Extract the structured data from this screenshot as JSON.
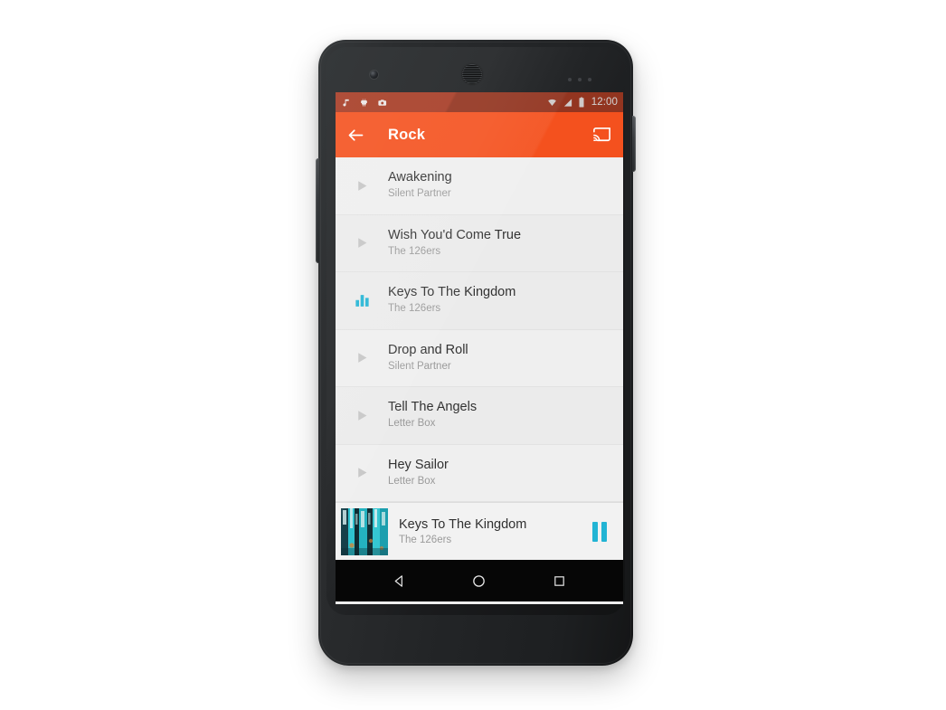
{
  "device": {
    "name": "android-phone-mockup",
    "hardware": {
      "front_camera": "camera-icon",
      "earpiece": "speaker-grille-icon",
      "sensors": "proximity-sensor",
      "volume_rocker": "volume-rocker-button",
      "power_button": "power-button"
    }
  },
  "status_bar": {
    "background": "#b24027",
    "notification_icons": [
      "music-note-icon",
      "android-icon",
      "photos-icon"
    ],
    "system_icons": [
      "wifi-icon",
      "signal-icon",
      "battery-icon"
    ],
    "time": "12:00"
  },
  "app_bar": {
    "background": "#f4511e",
    "back_label": "back-arrow",
    "title": "Rock",
    "cast_label": "cast-icon"
  },
  "songs": [
    {
      "title": "Awakening",
      "artist": "Silent Partner",
      "icon": "play-icon",
      "playing": false
    },
    {
      "title": "Wish You'd Come True",
      "artist": "The 126ers",
      "icon": "play-icon",
      "playing": false
    },
    {
      "title": "Keys To The Kingdom",
      "artist": "The 126ers",
      "icon": "equalizer-icon",
      "playing": true
    },
    {
      "title": "Drop and Roll",
      "artist": "Silent Partner",
      "icon": "play-icon",
      "playing": false
    },
    {
      "title": "Tell The Angels",
      "artist": "Letter Box",
      "icon": "play-icon",
      "playing": false
    },
    {
      "title": "Hey Sailor",
      "artist": "Letter Box",
      "icon": "play-icon",
      "playing": false
    }
  ],
  "now_playing": {
    "title": "Keys To The Kingdom",
    "artist": "The 126ers",
    "album_art": "album-art-teal-bottles",
    "control": "pause-button"
  },
  "nav_bar": {
    "back": "back-triangle-icon",
    "home": "home-circle-icon",
    "recents": "recents-square-icon"
  },
  "colors": {
    "accent": "#f4511e",
    "status_bar": "#b24027",
    "playing_highlight": "#22b4d4",
    "list_bg": "#efefef"
  }
}
